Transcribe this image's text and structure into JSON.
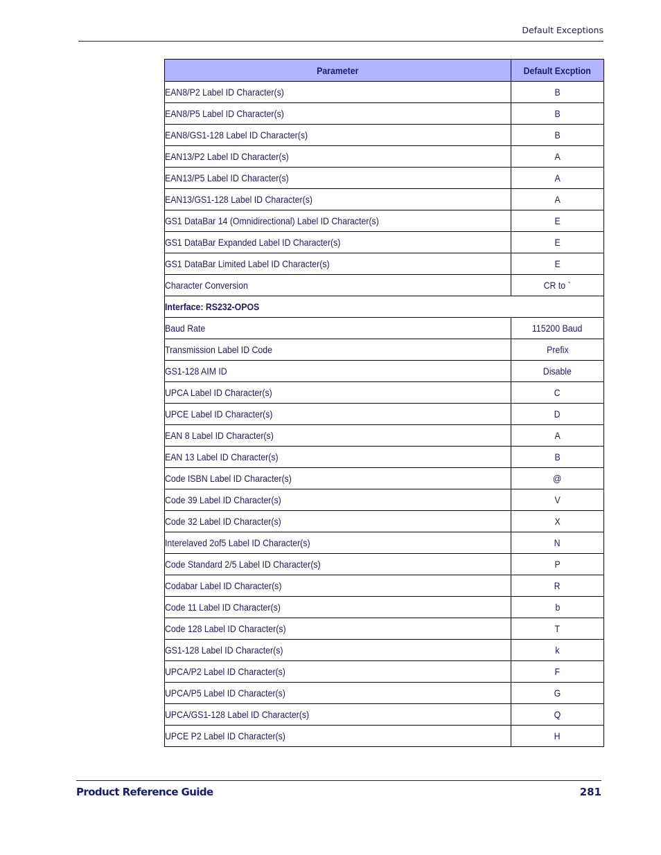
{
  "header": {
    "section_title": "Default Exceptions"
  },
  "table": {
    "columns": [
      "Parameter",
      "Default Excption"
    ],
    "rows_top": [
      {
        "parameter": "EAN8/P2 Label ID Character(s)",
        "value": "B"
      },
      {
        "parameter": "EAN8/P5 Label ID Character(s)",
        "value": "B"
      },
      {
        "parameter": "EAN8/GS1-128 Label ID Character(s)",
        "value": "B"
      },
      {
        "parameter": "EAN13/P2 Label ID Character(s)",
        "value": "A"
      },
      {
        "parameter": "EAN13/P5 Label ID Character(s)",
        "value": "A"
      },
      {
        "parameter": "EAN13/GS1-128 Label ID Character(s)",
        "value": "A"
      },
      {
        "parameter": "GS1 DataBar 14 (Omnidirectional) Label ID Character(s)",
        "value": "E"
      },
      {
        "parameter": "GS1 DataBar Expanded Label ID Character(s)",
        "value": "E"
      },
      {
        "parameter": "GS1 DataBar Limited Label ID Character(s)",
        "value": "E"
      },
      {
        "parameter": "Character Conversion",
        "value": "CR to `"
      }
    ],
    "section_heading": "Interface: RS232-OPOS",
    "rows_bottom": [
      {
        "parameter": "Baud Rate",
        "value": "115200 Baud"
      },
      {
        "parameter": "Transmission Label ID Code",
        "value": "Prefix"
      },
      {
        "parameter": "GS1-128 AIM ID",
        "value": "Disable"
      },
      {
        "parameter": "UPCA Label ID Character(s)",
        "value": "C"
      },
      {
        "parameter": "UPCE Label ID Character(s)",
        "value": "D"
      },
      {
        "parameter": "EAN 8 Label ID Character(s)",
        "value": "A"
      },
      {
        "parameter": "EAN 13 Label ID Character(s)",
        "value": "B"
      },
      {
        "parameter": "Code ISBN Label ID Character(s)",
        "value": "@"
      },
      {
        "parameter": "Code 39 Label ID Character(s)",
        "value": "V"
      },
      {
        "parameter": "Code 32 Label ID Character(s)",
        "value": "X"
      },
      {
        "parameter": "Interelaved 2of5 Label ID Character(s)",
        "value": "N"
      },
      {
        "parameter": "Code Standard 2/5 Label ID Character(s)",
        "value": "P"
      },
      {
        "parameter": "Codabar Label ID Character(s)",
        "value": "R"
      },
      {
        "parameter": "Code 11 Label ID Character(s)",
        "value": "b"
      },
      {
        "parameter": "Code 128 Label ID Character(s)",
        "value": "T"
      },
      {
        "parameter": "GS1-128 Label ID Character(s)",
        "value": "k"
      },
      {
        "parameter": "UPCA/P2 Label ID Character(s)",
        "value": "F"
      },
      {
        "parameter": "UPCA/P5 Label ID Character(s)",
        "value": "G"
      },
      {
        "parameter": "UPCA/GS1-128 Label ID Character(s)",
        "value": "Q"
      },
      {
        "parameter": "UPCE P2 Label ID Character(s)",
        "value": "H"
      }
    ]
  },
  "footer": {
    "title": "Product Reference Guide",
    "page_number": "281"
  },
  "colors": {
    "text": "#1a1a6e",
    "header_fill": "#b3b3ff",
    "border": "#000000"
  }
}
